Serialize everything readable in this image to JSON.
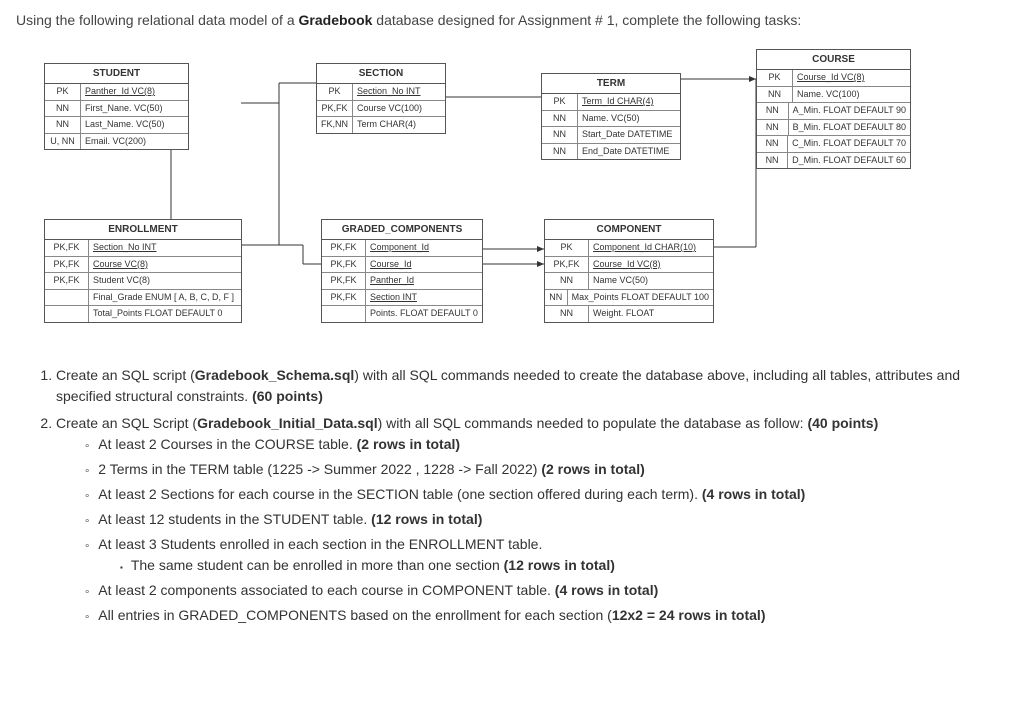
{
  "intro_prefix": "Using the following relational data model of a ",
  "intro_bold": "Gradebook",
  "intro_suffix": " database designed for Assignment # 1, complete the following tasks:",
  "entities": {
    "student": {
      "title": "STUDENT",
      "rows": [
        {
          "k": "PK",
          "a": "Panther_Id  VC(8)",
          "u": true
        },
        {
          "k": "NN",
          "a": "First_Nane.  VC(50)"
        },
        {
          "k": "NN",
          "a": "Last_Name.  VC(50)"
        },
        {
          "k": "U, NN",
          "a": "Email.  VC(200)"
        }
      ]
    },
    "section": {
      "title": "SECTION",
      "rows": [
        {
          "k": "PK",
          "a": "Section_No INT",
          "u": true
        },
        {
          "k": "PK,FK",
          "a": "Course VC(100)"
        },
        {
          "k": "FK,NN",
          "a": "Term CHAR(4)"
        }
      ]
    },
    "term": {
      "title": "TERM",
      "rows": [
        {
          "k": "PK",
          "a": "Term_Id  CHAR(4)",
          "u": true
        },
        {
          "k": "NN",
          "a": "Name.  VC(50)"
        },
        {
          "k": "NN",
          "a": "Start_Date  DATETIME"
        },
        {
          "k": "NN",
          "a": "End_Date   DATETIME"
        }
      ]
    },
    "course": {
      "title": "COURSE",
      "rows": [
        {
          "k": "PK",
          "a": "Course_Id  VC(8)",
          "u": true
        },
        {
          "k": "NN",
          "a": "Name.  VC(100)"
        },
        {
          "k": "NN",
          "a": "A_Min. FLOAT DEFAULT  90"
        },
        {
          "k": "NN",
          "a": "B_Min. FLOAT DEFAULT  80"
        },
        {
          "k": "NN",
          "a": "C_Min. FLOAT DEFAULT  70"
        },
        {
          "k": "NN",
          "a": "D_Min. FLOAT DEFAULT  60"
        }
      ]
    },
    "enrollment": {
      "title": "ENROLLMENT",
      "rows": [
        {
          "k": "PK,FK",
          "a": "Section_No INT",
          "u": true
        },
        {
          "k": "PK,FK",
          "a": "Course VC(8)",
          "u": true
        },
        {
          "k": "PK,FK",
          "a": "Student VC(8)"
        },
        {
          "k": "",
          "a": "Final_Grade ENUM [ A, B, C, D, F ]"
        },
        {
          "k": "",
          "a": "Total_Points FLOAT DEFAULT 0"
        }
      ]
    },
    "graded": {
      "title": "GRADED_COMPONENTS",
      "rows": [
        {
          "k": "PK,FK",
          "a": "Component_Id",
          "u": true
        },
        {
          "k": "PK,FK",
          "a": "Course_Id",
          "u": true
        },
        {
          "k": "PK,FK",
          "a": "Panther_Id",
          "u": true
        },
        {
          "k": "PK,FK",
          "a": "Section INT",
          "u": true
        },
        {
          "k": "",
          "a": "Points.  FLOAT DEFAULT 0"
        }
      ]
    },
    "component": {
      "title": "COMPONENT",
      "rows": [
        {
          "k": "PK",
          "a": "Component_Id CHAR(10)",
          "u": true
        },
        {
          "k": "PK,FK",
          "a": "Course_Id VC(8)",
          "u": true
        },
        {
          "k": "NN",
          "a": "Name VC(50)"
        },
        {
          "k": "NN",
          "a": "Max_Points FLOAT  DEFAULT 100"
        },
        {
          "k": "NN",
          "a": "Weight.  FLOAT"
        }
      ]
    }
  },
  "tasks": {
    "t1_a": "Create an SQL script (",
    "t1_b": "Gradebook_Schema.sql",
    "t1_c": ") with all SQL commands needed to create the database above, including all tables, attributes and specified structural constraints. ",
    "t1_d": "(60 points)",
    "t2_a": "Create an SQL Script (",
    "t2_b": "Gradebook_Initial_Data.sql",
    "t2_c": ") with all SQL commands needed to populate the database as follow:  ",
    "t2_d": "(40 points)",
    "b1_a": "At least 2 Courses in the COURSE table. ",
    "b1_b": "(2 rows in total)",
    "b2_a": "2 Terms in the TERM table (1225 -> Summer 2022 , 1228 -> Fall 2022) ",
    "b2_b": "(2 rows in total)",
    "b3_a": "At least 2 Sections for each course in the SECTION table  (one section offered during each term). ",
    "b3_b": "(4 rows in total)",
    "b4_a": "At least 12 students in the STUDENT table.  ",
    "b4_b": "(12 rows in total)",
    "b5_a": "At least 3 Students enrolled in each section in the ENROLLMENT table.",
    "b5s_a": "The same student can be enrolled in more than one section  ",
    "b5s_b": "(12 rows in total)",
    "b6_a": "At least 2 components associated to each course in COMPONENT table. ",
    "b6_b": "(4 rows in total)",
    "b7_a": "All entries in GRADED_COMPONENTS based on the enrollment for each section (",
    "b7_b": "12x2 = 24 rows in total)"
  }
}
